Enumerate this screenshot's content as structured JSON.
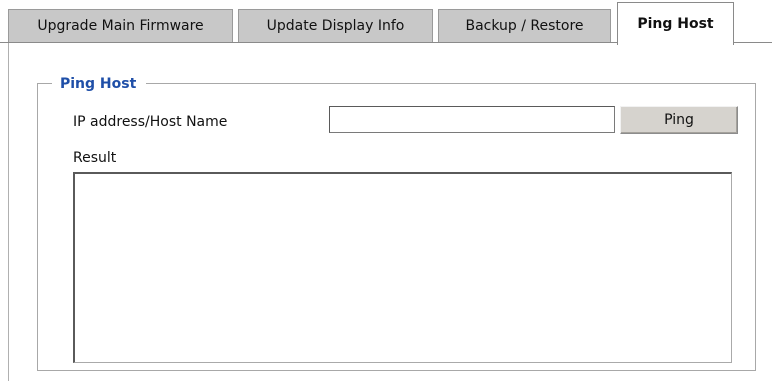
{
  "tabs": [
    {
      "label": "Upgrade Main Firmware",
      "active": false
    },
    {
      "label": "Update Display Info",
      "active": false
    },
    {
      "label": "Backup / Restore",
      "active": false
    },
    {
      "label": "Ping Host",
      "active": true
    }
  ],
  "group": {
    "legend": "Ping Host",
    "legend_color": "#1f4fa8"
  },
  "form": {
    "ip_label": "IP address/Host Name",
    "ip_value": "",
    "ping_button": "Ping",
    "result_label": "Result",
    "result_value": ""
  }
}
